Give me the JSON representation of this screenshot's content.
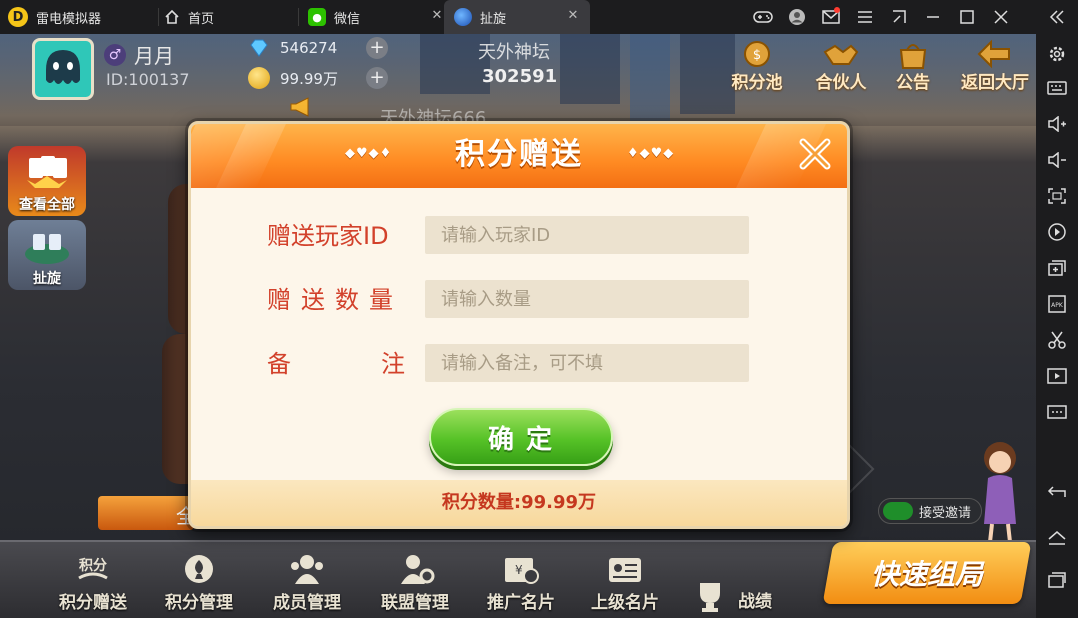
{
  "window": {
    "tabs": [
      {
        "label": "雷电模拟器"
      },
      {
        "label": "首页"
      },
      {
        "label": "微信"
      },
      {
        "label": "扯旋"
      }
    ]
  },
  "player": {
    "name": "月月",
    "id": "ID:100137"
  },
  "resources": {
    "diamonds": "546274",
    "gold": "99.99万"
  },
  "room": {
    "title": "天外神坛",
    "number": "302591",
    "marquee": "天外神坛666"
  },
  "top_buttons": [
    {
      "label": "积分池",
      "icon": "points-pool-icon"
    },
    {
      "label": "合伙人",
      "icon": "handshake-icon"
    },
    {
      "label": "公告",
      "icon": "notice-bag-icon"
    },
    {
      "label": "返回大厅",
      "icon": "back-arrow-icon"
    }
  ],
  "left_buttons": [
    {
      "label": "查看全部",
      "icon": "cards-crown-icon"
    },
    {
      "label": "扯旋",
      "icon": "table-cards-icon"
    }
  ],
  "bottom_nav": [
    {
      "label": "积分赠送",
      "icon_text": "积分"
    },
    {
      "label": "积分管理",
      "icon": "coin-spade-icon"
    },
    {
      "label": "成员管理",
      "icon": "members-icon"
    },
    {
      "label": "联盟管理",
      "icon": "alliance-gear-icon"
    },
    {
      "label": "推广名片",
      "icon": "promo-card-icon"
    },
    {
      "label": "上级名片",
      "icon": "id-card-icon"
    },
    {
      "label": "战绩",
      "icon": "trophy-icon"
    }
  ],
  "quick_match": "快速组局",
  "accept_invite": "接受邀请",
  "orange_bar_text": "全",
  "modal": {
    "title": "积分赠送",
    "fields": [
      {
        "label": "赠送玩家ID",
        "placeholder": "请输入玩家ID"
      },
      {
        "label": "赠送数量",
        "placeholder": "请输入数量"
      },
      {
        "label": "备注",
        "placeholder": "请输入备注，可不填"
      }
    ],
    "confirm_label": "确定",
    "points_text": "积分数量:99.99万"
  },
  "colors": {
    "modal_header": "#ff8a22",
    "label_red": "#d2412b",
    "confirm_green": "#56c227"
  }
}
